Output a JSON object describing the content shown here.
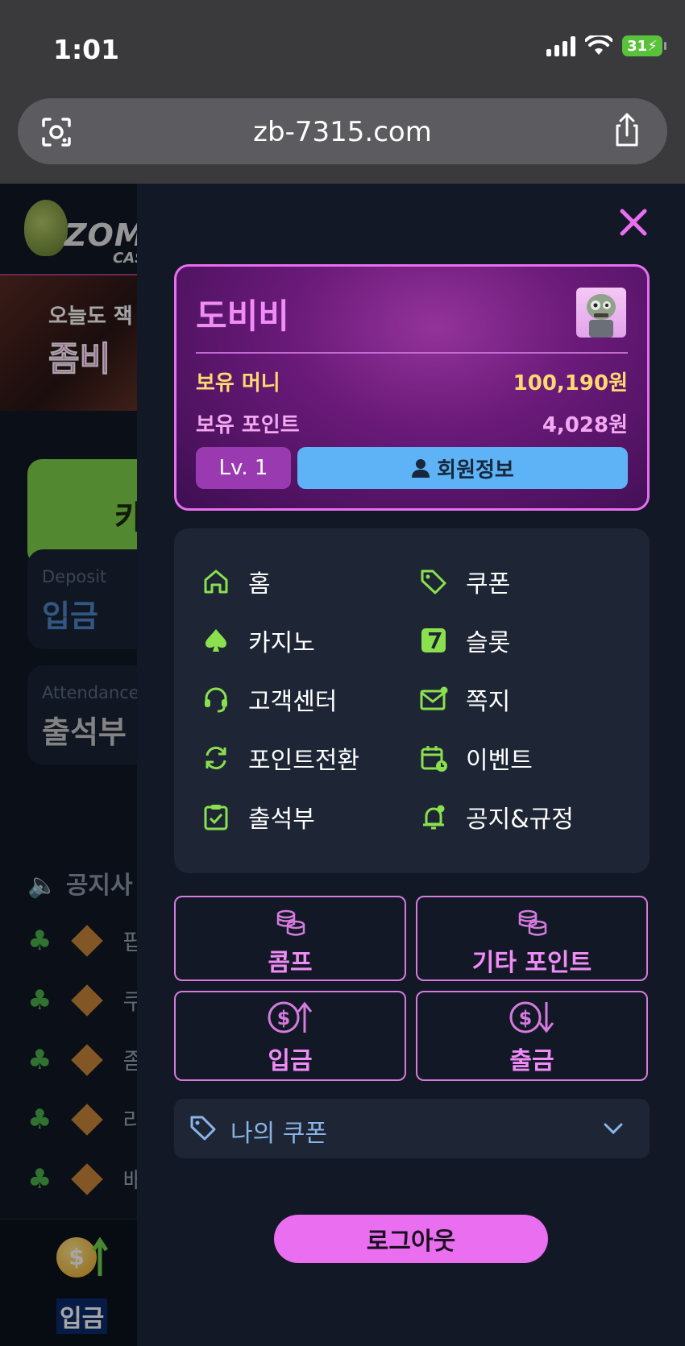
{
  "status_bar": {
    "time": "1:01",
    "battery": "31"
  },
  "browser": {
    "url": "zb-7315.com"
  },
  "background_site": {
    "logo_text": "ZOMB",
    "logo_sub": "CASINO",
    "banner_line1": "오늘도 잭",
    "banner_line2": "좀비",
    "green_button_char": "카",
    "deposit_card": {
      "small": "Deposit",
      "big": "입금",
      "big_color": "#4e86c9"
    },
    "attendance_card": {
      "small": "Attendance",
      "big": "출석부",
      "big_color": "#c9c9c9"
    },
    "notice_title": "공지사",
    "notice_rows": [
      "팝",
      "쿠",
      "좀",
      "라",
      "배"
    ],
    "footer_label": "입금"
  },
  "profile": {
    "name": "도비비",
    "money_label": "보유 머니",
    "money_value": "100,190원",
    "points_label": "보유 포인트",
    "points_value": "4,028원",
    "level": "Lv. 1",
    "member_info_label": "회원정보"
  },
  "menu": {
    "home": "홈",
    "coupon": "쿠폰",
    "casino": "카지노",
    "slot": "슬롯",
    "support": "고객센터",
    "message": "쪽지",
    "point_convert": "포인트전환",
    "event": "이벤트",
    "attendance": "출석부",
    "notice_rules": "공지&규정"
  },
  "actions": {
    "comp": "콤프",
    "other_points": "기타 포인트",
    "deposit": "입금",
    "withdraw": "출금"
  },
  "my_coupon": "나의 쿠폰",
  "logout": "로그아웃",
  "colors": {
    "accent_pink": "#e96ff0",
    "accent_green": "#8be04e",
    "accent_blue": "#5db3f5",
    "gold": "#ffd970"
  }
}
